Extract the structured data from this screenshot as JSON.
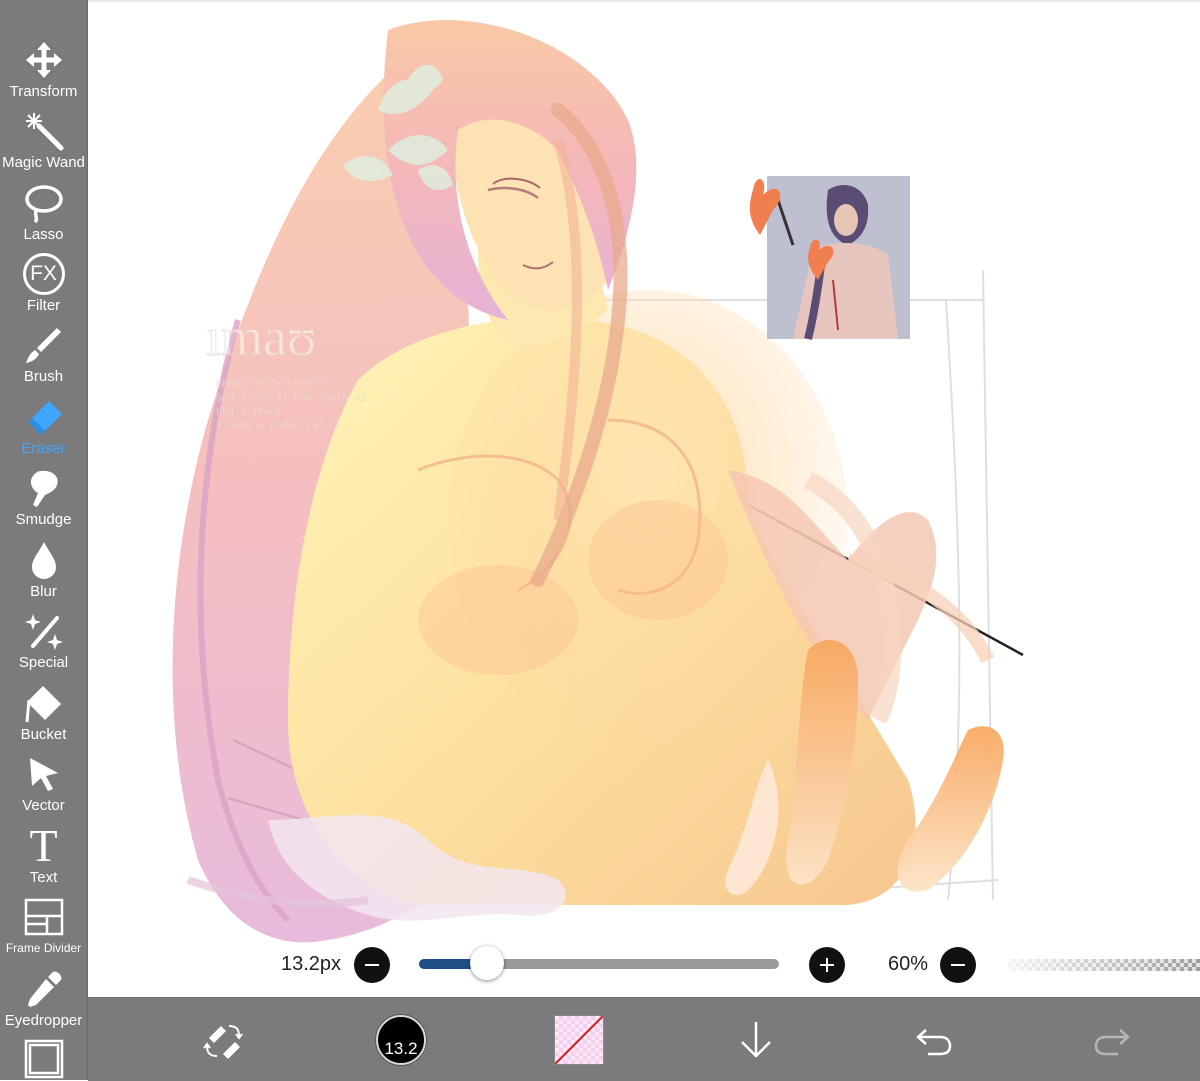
{
  "toolbar": {
    "tools": [
      {
        "label": "Transform",
        "icon": "move-arrows-icon"
      },
      {
        "label": "Magic Wand",
        "icon": "magic-wand-icon"
      },
      {
        "label": "Lasso",
        "icon": "lasso-icon"
      },
      {
        "label": "Filter",
        "icon": "fx-icon",
        "icon_text": "FX"
      },
      {
        "label": "Brush",
        "icon": "brush-icon"
      },
      {
        "label": "Eraser",
        "icon": "eraser-icon",
        "active": true
      },
      {
        "label": "Smudge",
        "icon": "smudge-icon"
      },
      {
        "label": "Blur",
        "icon": "drop-icon"
      },
      {
        "label": "Special",
        "icon": "sparkle-icon"
      },
      {
        "label": "Bucket",
        "icon": "bucket-icon"
      },
      {
        "label": "Vector",
        "icon": "cursor-arrow-icon"
      },
      {
        "label": "Text",
        "icon": "text-icon",
        "icon_text": "T"
      },
      {
        "label": "Frame Divider",
        "icon": "frame-divider-icon"
      },
      {
        "label": "Eyedropper",
        "icon": "eyedropper-icon"
      },
      {
        "label": "",
        "icon": "canvas-icon"
      }
    ],
    "active_color": "#3ea6ff"
  },
  "canvas": {
    "watermark": {
      "signature": "ımaʊ",
      "lines": [
        "REPOST WITH CREDIT",
        "DON'T USE IT FOR TRAIN AI",
        "DON'T TRACE",
        "I HAVE A FERAL CAT"
      ]
    }
  },
  "brush": {
    "size_label": "13.2px",
    "size_fraction": 0.19,
    "opacity_label": "60%",
    "slider_fill_color": "#1f4f86"
  },
  "bottombar": {
    "brush_badge": "13.2",
    "items": [
      "swap-tools-icon",
      "brush-size-badge",
      "color-swatch",
      "download-arrow-icon",
      "undo-icon",
      "redo-icon"
    ]
  }
}
